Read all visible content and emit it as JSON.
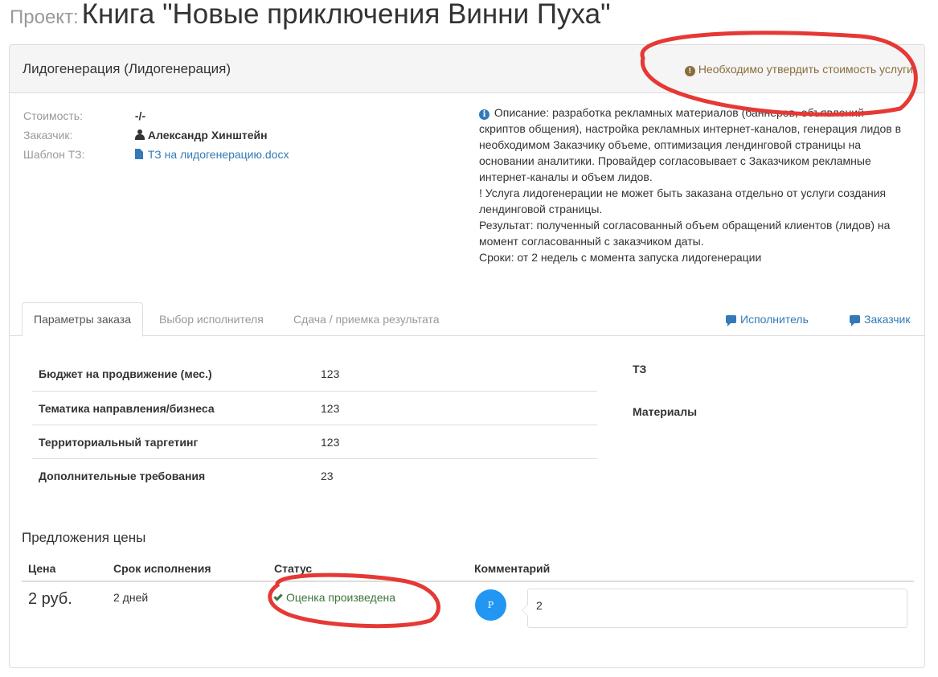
{
  "header": {
    "label": "Проект:",
    "title": "Книга \"Новые приключения Винни Пуха\""
  },
  "panel": {
    "title": "Лидогенерация (Лидогенерация)",
    "warning": "Необходимо утвердить стоимость услуги"
  },
  "meta": {
    "cost_label": "Стоимость:",
    "cost_value": "-/-",
    "customer_label": "Заказчик:",
    "customer_value": "Александр Хинштейн",
    "template_label": "Шаблон ТЗ:",
    "template_value": "ТЗ на лидогенерацию.docx"
  },
  "description": {
    "lines": [
      "Описание: разработка рекламных материалов (баннеров, объявлений скриптов общения), настройка рекламных интернет-каналов, генерация лидов в необходимом Заказчику объеме, оптимизация лендинговой страницы на основании аналитики. Провайдер согласовывает с Заказчиком рекламные интернет-каналы и объем лидов.",
      "! Услуга лидогенерации не может быть заказана отдельно от услуги создания лендинговой страницы.",
      "Результат: полученный согласованный объем обращений клиентов (лидов) на момент согласованный с заказчиком даты.",
      "Сроки: от 2 недель с момента запуска лидогенерации"
    ]
  },
  "tabs": {
    "params": "Параметры заказа",
    "executor_choice": "Выбор исполнителя",
    "delivery": "Сдача / приемка результата",
    "executor_chat": "Исполнитель",
    "customer_chat": "Заказчик"
  },
  "params": [
    {
      "label": "Бюджет на продвижение (мес.)",
      "value": "123"
    },
    {
      "label": "Тематика направления/бизнеса",
      "value": "123"
    },
    {
      "label": "Территориальный таргетинг",
      "value": "123"
    },
    {
      "label": "Дополнительные требования",
      "value": "23"
    }
  ],
  "side": {
    "tz": "ТЗ",
    "materials": "Материалы"
  },
  "offers": {
    "title": "Предложения цены",
    "columns": {
      "price": "Цена",
      "term": "Срок исполнения",
      "status": "Статус",
      "comment": "Комментарий"
    },
    "rows": [
      {
        "price": "2 руб.",
        "term": "2 дней",
        "status": "Оценка произведена",
        "avatar": "Р",
        "comment": "2"
      }
    ]
  },
  "colors": {
    "link": "#337ab7",
    "warning": "#8a6d3b",
    "success": "#3c763d",
    "annotation": "#e53935",
    "avatar": "#2196f3"
  }
}
